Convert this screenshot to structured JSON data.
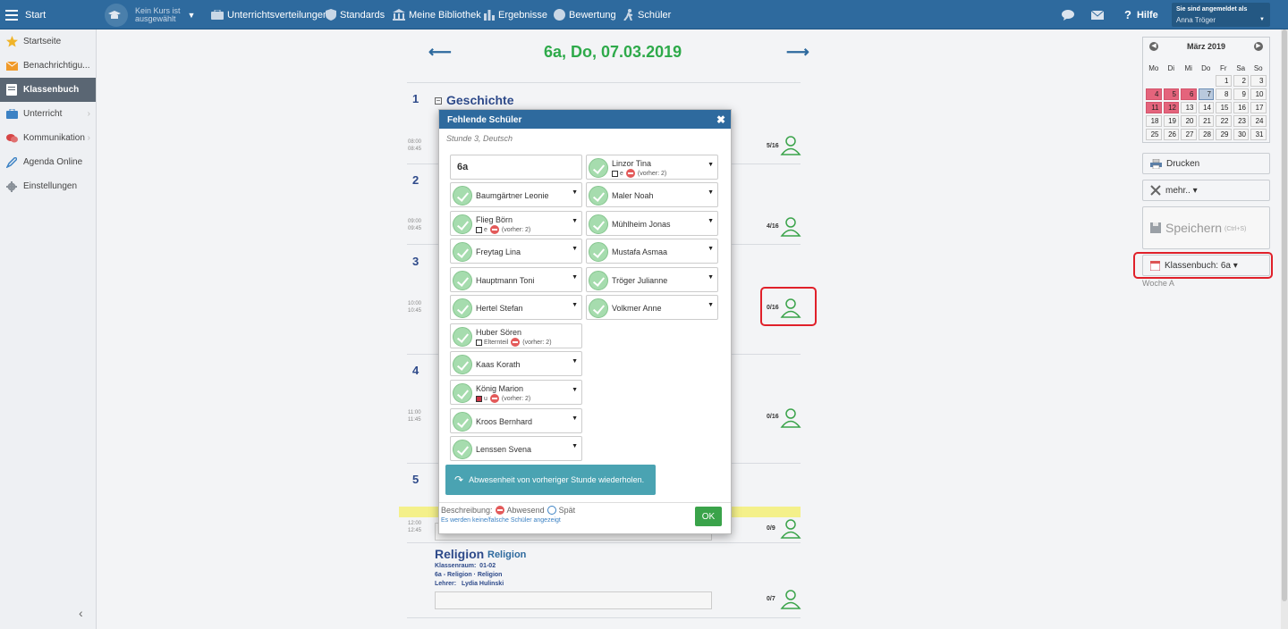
{
  "topbar": {
    "start": "Start",
    "course": "Kein Kurs ist ausgewählt",
    "course_l1": "Kein Kurs ist",
    "course_l2": "ausgewählt",
    "nav": [
      "Unterrichtsverteilungen",
      "Standards",
      "Meine Bibliothek",
      "Ergebnisse",
      "Bewertung",
      "Schüler"
    ],
    "help": "Hilfe",
    "logged_in_label": "Sie sind angemeldet als",
    "user": "Anna Tröger"
  },
  "sidebar": {
    "items": [
      {
        "label": "Startseite",
        "icon": "star-icon"
      },
      {
        "label": "Benachrichtigu...",
        "icon": "envelope-icon"
      },
      {
        "label": "Klassenbuch",
        "icon": "book-icon",
        "active": true
      },
      {
        "label": "Unterricht",
        "icon": "briefcase-icon"
      },
      {
        "label": "Kommunikation",
        "icon": "chat-icon"
      },
      {
        "label": "Agenda Online",
        "icon": "pen-icon"
      },
      {
        "label": "Einstellungen",
        "icon": "gear-icon"
      }
    ]
  },
  "main": {
    "date_title": "6a, Do, 07.03.2019",
    "lessons": [
      {
        "num": "1",
        "subject": "Geschichte",
        "t1": "08:00",
        "t2": "08:45",
        "count": "5/16"
      },
      {
        "num": "2",
        "t1": "09:00",
        "t2": "09:45",
        "count": "4/16"
      },
      {
        "num": "3",
        "t1": "10:00",
        "t2": "10:45",
        "count": "0/16"
      },
      {
        "num": "4",
        "t1": "11:00",
        "t2": "11:45",
        "count": "0/16"
      },
      {
        "num": "5",
        "t1": "12:00",
        "t2": "12:45",
        "count": "0/9"
      }
    ],
    "religion": {
      "title": "Religion",
      "subtitle": "Religion",
      "room": "Klassenraum:  01-02",
      "course": "6a - Religion · Religion",
      "teacher": "Lehrer:   Lydia Hulinski",
      "count": "0/7"
    }
  },
  "modal": {
    "title": "Fehlende Schüler",
    "subtitle": "Stunde 3, Deutsch",
    "class_label": "6a",
    "left": [
      {
        "name": "Baumgärtner Leonie"
      },
      {
        "name": "Flieg Börn",
        "tag": "e",
        "prev": "(vorher: 2)"
      },
      {
        "name": "Freytag Lina"
      },
      {
        "name": "Hauptmann Toni"
      },
      {
        "name": "Hertel Stefan"
      },
      {
        "name": "Huber Sören",
        "tag": "Elternteil",
        "prev": "(vorher: 2)"
      },
      {
        "name": "Kaas Korath"
      },
      {
        "name": "König Marion",
        "tag": "u",
        "prev": "(vorher: 2)"
      },
      {
        "name": "Kroos Bernhard"
      },
      {
        "name": "Lenssen Svena"
      }
    ],
    "right": [
      {
        "name": "Linzor Tina",
        "tag": "e",
        "prev": "(vorher: 2)"
      },
      {
        "name": "Maler Noah"
      },
      {
        "name": "Mühlheim Jonas"
      },
      {
        "name": "Mustafa Asmaa"
      },
      {
        "name": "Tröger Julianne"
      },
      {
        "name": "Volkmer Anne"
      }
    ],
    "repeat_btn": "Abwesenheit von vorheriger Stunde wiederholen.",
    "legend_label": "Beschreibung:",
    "legend_absent": "Abwesend",
    "legend_late": "Spät",
    "wrong_link": "Es werden keine/falsche Schüler angezeigt",
    "ok": "OK"
  },
  "calendar": {
    "month": "März 2019",
    "weekdays": [
      "Mo",
      "Di",
      "Mi",
      "Do",
      "Fr",
      "Sa",
      "So"
    ],
    "rows": [
      [
        "",
        "",
        "",
        "",
        "1",
        "2",
        "3"
      ],
      [
        "4",
        "5",
        "6",
        "7",
        "8",
        "9",
        "10"
      ],
      [
        "11",
        "12",
        "13",
        "14",
        "15",
        "16",
        "17"
      ],
      [
        "18",
        "19",
        "20",
        "21",
        "22",
        "23",
        "24"
      ],
      [
        "25",
        "26",
        "27",
        "28",
        "29",
        "30",
        "31"
      ]
    ],
    "pink": [
      "4",
      "5",
      "6",
      "11",
      "12"
    ],
    "selected": "7"
  },
  "right": {
    "print": "Drucken",
    "more": "mehr.. ▾",
    "save": "Speichern",
    "save_hint": "(Ctrl+S)",
    "classbook": "Klassenbuch: 6a ▾",
    "week": "Woche A"
  },
  "colors": {
    "brand": "#2e6a9e",
    "green": "#2eaa4a",
    "pink": "#e4647c",
    "teal": "#4aa3b2",
    "highlight_red": "#e0202a"
  }
}
